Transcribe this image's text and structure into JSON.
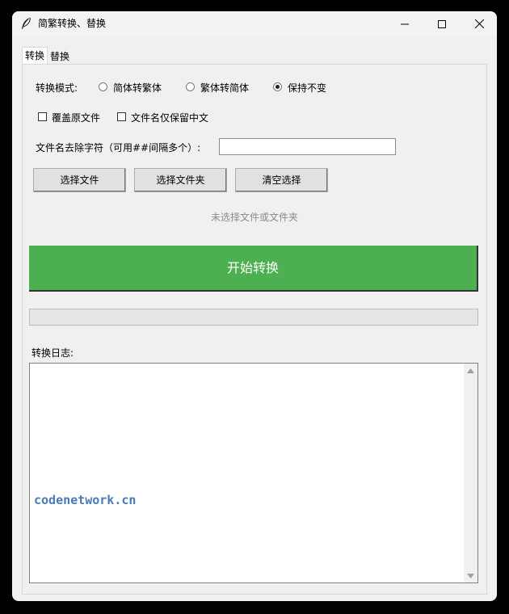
{
  "window": {
    "title": "简繁转换、替换"
  },
  "tabs": [
    {
      "label": "转换",
      "active": true
    },
    {
      "label": "替换",
      "active": false
    }
  ],
  "mode": {
    "label": "转换模式:",
    "options": [
      {
        "label": "简体转繁体",
        "checked": false
      },
      {
        "label": "繁体转简体",
        "checked": false
      },
      {
        "label": "保持不变",
        "checked": true
      }
    ]
  },
  "options": {
    "overwrite": {
      "label": "覆盖原文件",
      "checked": false
    },
    "chinese_only": {
      "label": "文件名仅保留中文",
      "checked": false
    }
  },
  "strip_chars": {
    "label": "文件名去除字符（可用##间隔多个）:",
    "value": ""
  },
  "buttons": {
    "select_file": "选择文件",
    "select_folder": "选择文件夹",
    "clear_selection": "清空选择",
    "start": "开始转换"
  },
  "status": "未选择文件或文件夹",
  "progress": {
    "value": 0
  },
  "log": {
    "label": "转换日志:",
    "watermark": "codenetwork.cn"
  },
  "colors": {
    "start_button": "#4caf50",
    "status_text": "#8a8a8a",
    "watermark": "#4a7bb7"
  }
}
